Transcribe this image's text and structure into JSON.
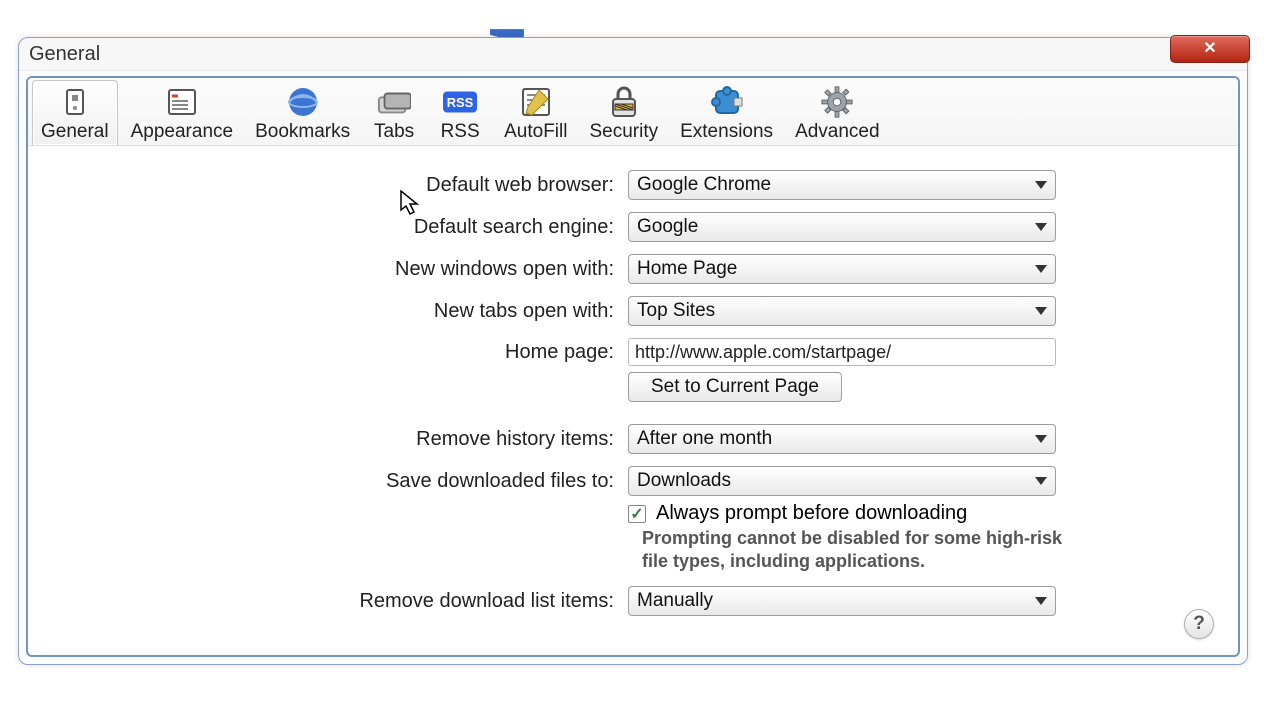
{
  "window": {
    "title": "General"
  },
  "toolbar": {
    "tabs": [
      {
        "label": "General",
        "icon": "general-icon"
      },
      {
        "label": "Appearance",
        "icon": "appearance-icon"
      },
      {
        "label": "Bookmarks",
        "icon": "bookmarks-icon"
      },
      {
        "label": "Tabs",
        "icon": "tabs-icon"
      },
      {
        "label": "RSS",
        "icon": "rss-icon"
      },
      {
        "label": "AutoFill",
        "icon": "autofill-icon"
      },
      {
        "label": "Security",
        "icon": "security-icon"
      },
      {
        "label": "Extensions",
        "icon": "extensions-icon"
      },
      {
        "label": "Advanced",
        "icon": "advanced-icon"
      }
    ],
    "selected": 0
  },
  "labels": {
    "default_browser": "Default web browser:",
    "default_search": "Default search engine:",
    "new_windows": "New windows open with:",
    "new_tabs": "New tabs open with:",
    "home_page": "Home page:",
    "remove_history": "Remove history items:",
    "save_downloads": "Save downloaded files to:",
    "remove_downloads": "Remove download list items:"
  },
  "values": {
    "default_browser": "Google Chrome",
    "default_search": "Google",
    "new_windows": "Home Page",
    "new_tabs": "Top Sites",
    "home_page": "http://www.apple.com/startpage/",
    "remove_history": "After one month",
    "save_downloads": "Downloads",
    "remove_downloads": "Manually"
  },
  "buttons": {
    "set_current": "Set to Current Page",
    "help": "?"
  },
  "checkbox": {
    "prompt_download_label": "Always prompt before downloading",
    "prompt_download_checked": true,
    "prompt_hint": "Prompting cannot be disabled for some high-risk file types, including applications."
  }
}
